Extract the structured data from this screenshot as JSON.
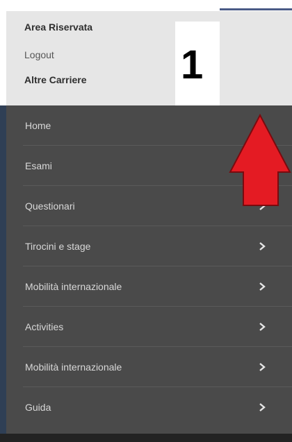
{
  "header": {
    "title": "Area Riservata",
    "logout_label": "Logout",
    "altre_carriere_label": "Altre Carriere"
  },
  "annotation": {
    "number": "1",
    "arrow_color": "#e41b23"
  },
  "menu": {
    "items": [
      {
        "label": "Home"
      },
      {
        "label": "Esami"
      },
      {
        "label": "Questionari"
      },
      {
        "label": "Tirocini e stage"
      },
      {
        "label": "Mobilità internazionale"
      },
      {
        "label": "Activities"
      },
      {
        "label": "Mobilità internazionale"
      },
      {
        "label": "Guida"
      }
    ],
    "chevron_icon": "chevron-right-icon"
  },
  "colors": {
    "header_bg": "#e6e6e6",
    "menu_bg": "#4a4a4a",
    "menu_text": "#d8d8d8"
  }
}
